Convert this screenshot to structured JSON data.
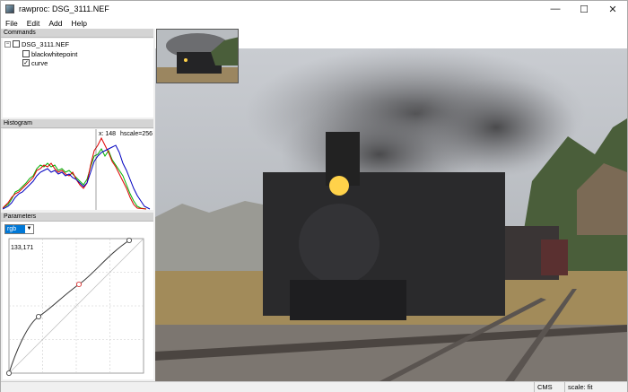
{
  "window": {
    "title": "rawproc: DSG_3111.NEF",
    "minimize": "—",
    "maximize": "☐",
    "close": "✕"
  },
  "menu": [
    "File",
    "Edit",
    "Add",
    "Help"
  ],
  "panels": {
    "commands": "Commands",
    "histogram": "Histogram",
    "parameters": "Parameters"
  },
  "tree": {
    "root": "DSG_3111.NEF",
    "root_expander": "−",
    "items": [
      {
        "label": "blackwhitepoint",
        "checked": false
      },
      {
        "label": "curve",
        "checked": true,
        "check_mark": "✓"
      }
    ]
  },
  "histogram": {
    "x_label": "x: 148",
    "hscale_label": "hscale=256"
  },
  "parameters": {
    "channel": "rgb",
    "channel_arrow": "▼",
    "coord_readout": "133,171",
    "curve_points": [
      [
        0,
        0
      ],
      [
        64,
        80
      ],
      [
        148,
        168
      ],
      [
        255,
        255
      ]
    ]
  },
  "status": {
    "cms": "CMS",
    "scale": "scale: fit"
  },
  "colors": {
    "select_accent": "#0078d7",
    "hist_red": "#e00000",
    "hist_green": "#00b000",
    "hist_blue": "#0000c0"
  }
}
